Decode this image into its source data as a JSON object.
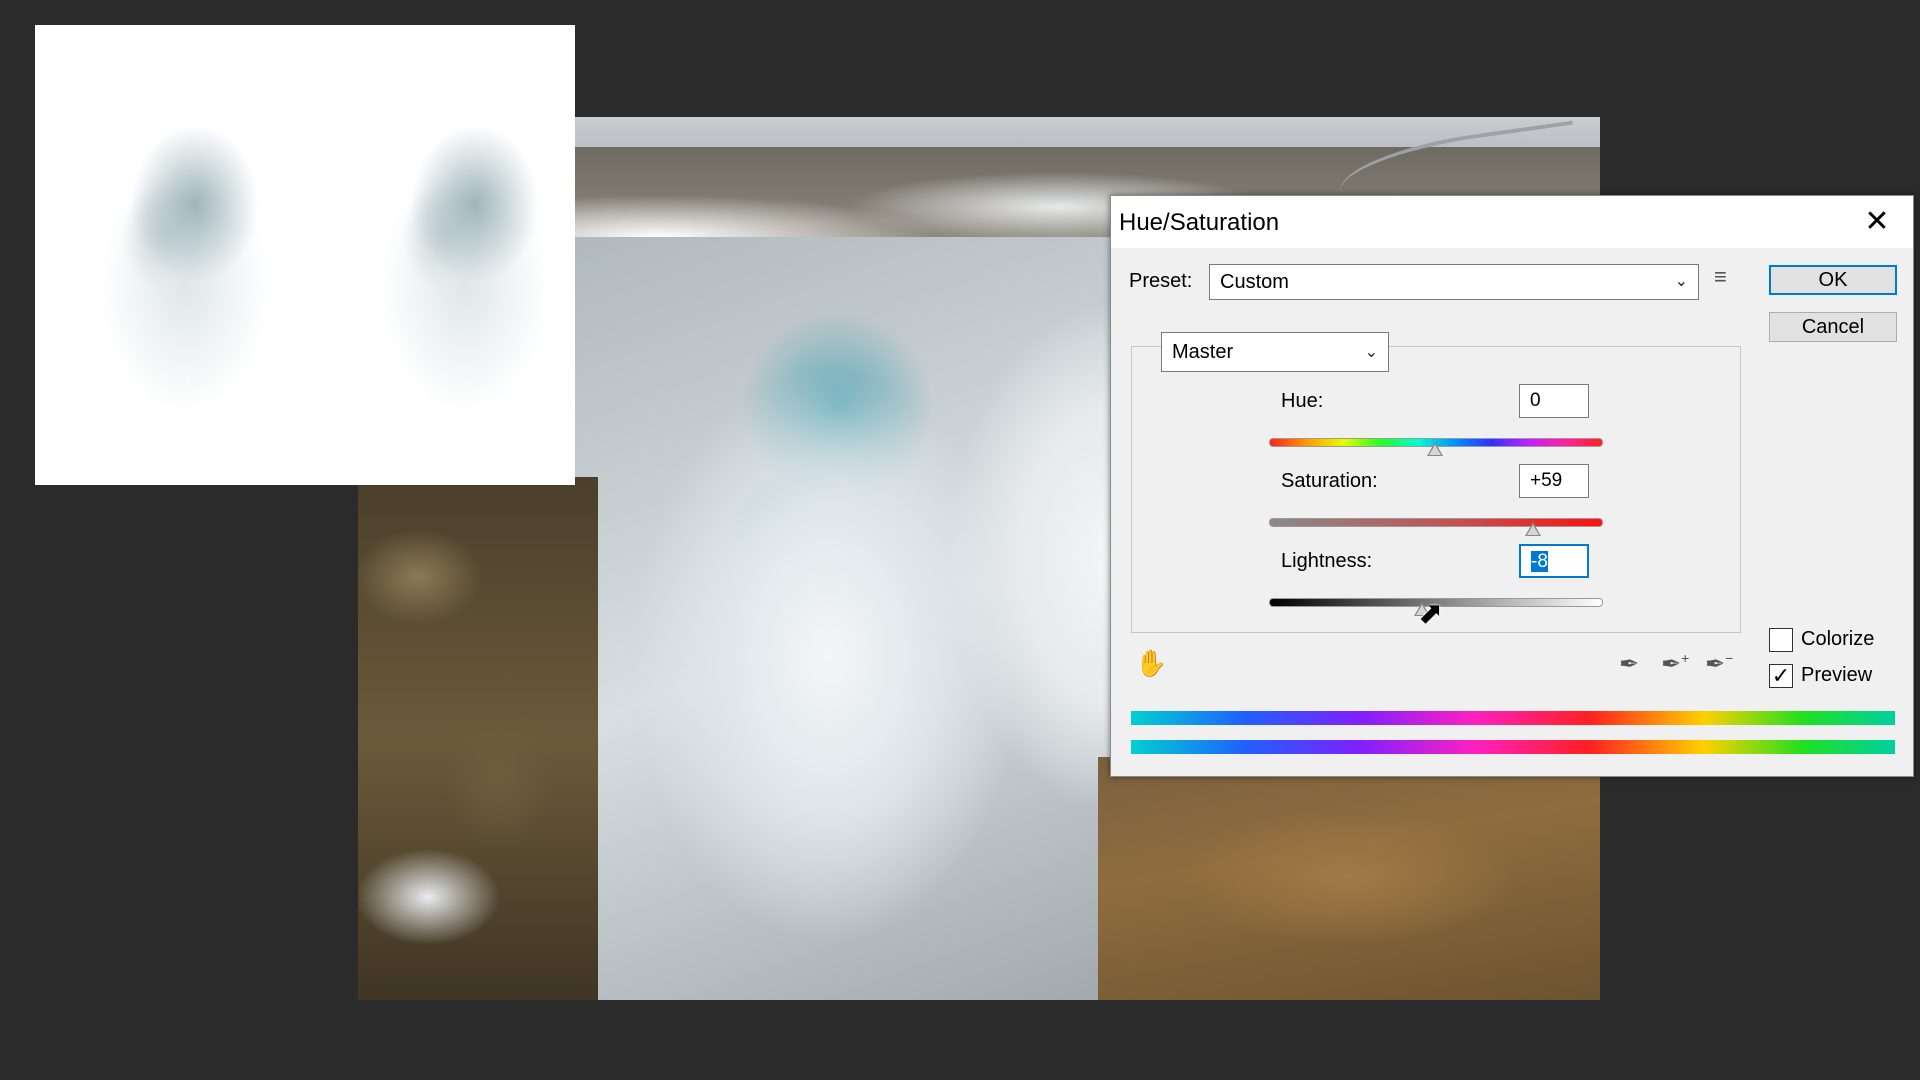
{
  "dialog": {
    "title": "Hue/Saturation",
    "close_glyph": "✕",
    "preset_label": "Preset:",
    "preset_value": "Custom",
    "preset_menu_icon": "preset-options-icon",
    "ok_label": "OK",
    "cancel_label": "Cancel",
    "channel_value": "Master",
    "hue": {
      "label": "Hue:",
      "value": "0",
      "slider_fraction": 0.5
    },
    "saturation": {
      "label": "Saturation:",
      "value": "+59",
      "slider_fraction": 0.795
    },
    "lightness": {
      "label": "Lightness:",
      "value": "-8",
      "slider_fraction": 0.46
    },
    "colorize": {
      "label": "Colorize",
      "checked": false
    },
    "preview": {
      "label": "Preview",
      "checked": true
    },
    "icons": {
      "adjust_hand": "targeted-adjustment-hand-icon",
      "eyedropper": "eyedropper-icon",
      "eyedropper_add": "eyedropper-add-icon",
      "eyedropper_subtract": "eyedropper-subtract-icon"
    },
    "colors": {
      "accent": "#0078d7",
      "dialog_bg": "#f0f0f0"
    }
  }
}
